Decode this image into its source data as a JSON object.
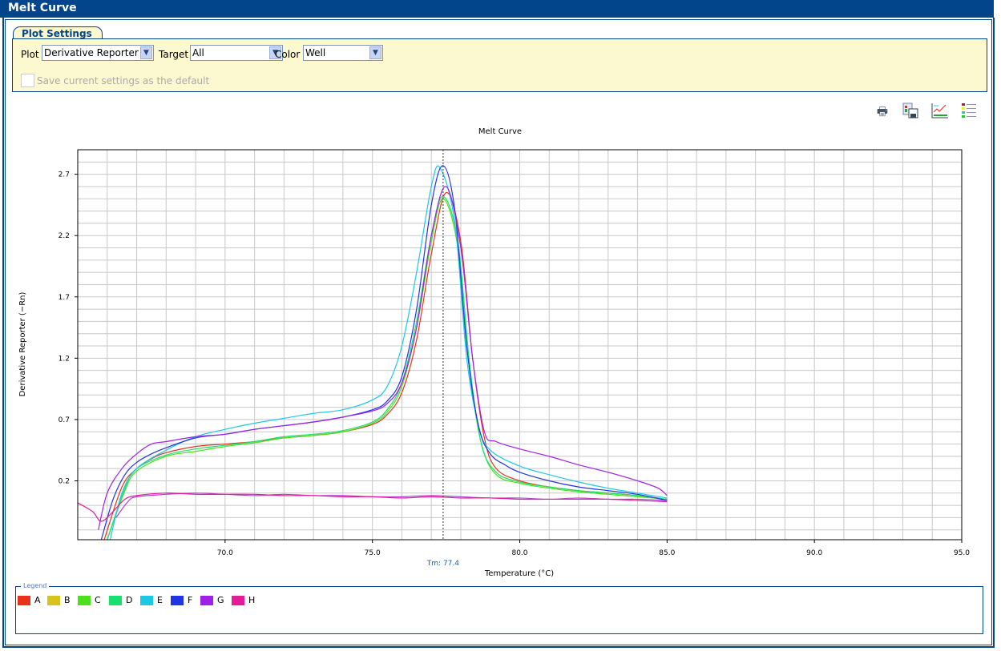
{
  "window": {
    "title": "Melt Curve"
  },
  "settings": {
    "tab": "Plot Settings",
    "plot_label": "Plot",
    "plot_value": "Derivative Reporter",
    "target_label": "Target",
    "target_value": "All",
    "color_label": "Color",
    "color_value": "Well",
    "save_default": "Save current settings as the default"
  },
  "toolbar": {
    "icons": [
      "print-icon",
      "save-image-icon",
      "edit-graph-icon",
      "legend-list-icon"
    ]
  },
  "legend": {
    "title": "Legend",
    "items": [
      {
        "label": "A",
        "color": "#e8321c"
      },
      {
        "label": "B",
        "color": "#d8c21c"
      },
      {
        "label": "C",
        "color": "#4ee01c"
      },
      {
        "label": "D",
        "color": "#18e070"
      },
      {
        "label": "E",
        "color": "#1cc8e6"
      },
      {
        "label": "F",
        "color": "#2034e4"
      },
      {
        "label": "G",
        "color": "#a020e8"
      },
      {
        "label": "H",
        "color": "#e41c98"
      }
    ]
  },
  "chart_data": {
    "type": "line",
    "title": "Melt Curve",
    "xlabel": "Temperature (°C)",
    "ylabel": "Derivative Reporter (−Rn)",
    "xlim": [
      65,
      95
    ],
    "ylim": [
      -0.28,
      2.9
    ],
    "xticks": [
      "70.0",
      "75.0",
      "80.0",
      "85.0",
      "90.0",
      "95.0"
    ],
    "yticks": [
      "0.2",
      "0.7",
      "1.2",
      "1.7",
      "2.2",
      "2.7"
    ],
    "grid": true,
    "annotation": {
      "label": "Tm: 77.4",
      "x": 77.4
    },
    "series": [
      {
        "name": "A",
        "color": "#e8321c",
        "points": [
          [
            65.9,
            -0.28
          ],
          [
            66.5,
            0.15
          ],
          [
            67,
            0.3
          ],
          [
            67.5,
            0.38
          ],
          [
            68,
            0.43
          ],
          [
            69,
            0.48
          ],
          [
            70,
            0.5
          ],
          [
            71,
            0.52
          ],
          [
            72,
            0.55
          ],
          [
            73,
            0.57
          ],
          [
            74,
            0.6
          ],
          [
            75,
            0.66
          ],
          [
            75.5,
            0.74
          ],
          [
            76,
            0.92
          ],
          [
            76.5,
            1.35
          ],
          [
            77,
            2.05
          ],
          [
            77.5,
            2.55
          ],
          [
            78,
            2.15
          ],
          [
            78.4,
            1.2
          ],
          [
            78.8,
            0.55
          ],
          [
            79.2,
            0.3
          ],
          [
            80,
            0.2
          ],
          [
            81,
            0.15
          ],
          [
            82,
            0.12
          ],
          [
            83,
            0.1
          ],
          [
            84,
            0.08
          ],
          [
            85,
            0.05
          ]
        ]
      },
      {
        "name": "B",
        "color": "#b83ed0",
        "points": [
          [
            66.3,
            -0.1
          ],
          [
            66.7,
            0.03
          ],
          [
            67,
            0.07
          ],
          [
            68,
            0.09
          ],
          [
            69,
            0.1
          ],
          [
            70,
            0.09
          ],
          [
            71,
            0.08
          ],
          [
            72,
            0.09
          ],
          [
            73,
            0.08
          ],
          [
            74,
            0.08
          ],
          [
            75,
            0.07
          ],
          [
            76,
            0.07
          ],
          [
            77,
            0.08
          ],
          [
            78,
            0.07
          ],
          [
            79,
            0.06
          ],
          [
            80,
            0.06
          ],
          [
            81,
            0.05
          ],
          [
            82,
            0.06
          ],
          [
            83,
            0.05
          ],
          [
            84,
            0.05
          ],
          [
            85,
            0.04
          ]
        ]
      },
      {
        "name": "C",
        "color": "#4ee01c",
        "points": [
          [
            66,
            -0.28
          ],
          [
            66.6,
            0.12
          ],
          [
            67,
            0.28
          ],
          [
            68,
            0.4
          ],
          [
            69,
            0.44
          ],
          [
            70,
            0.48
          ],
          [
            71,
            0.51
          ],
          [
            72,
            0.55
          ],
          [
            73,
            0.57
          ],
          [
            74,
            0.6
          ],
          [
            75,
            0.67
          ],
          [
            75.5,
            0.76
          ],
          [
            76,
            0.97
          ],
          [
            76.5,
            1.45
          ],
          [
            77,
            2.15
          ],
          [
            77.4,
            2.5
          ],
          [
            77.9,
            2.1
          ],
          [
            78.3,
            1.1
          ],
          [
            78.7,
            0.5
          ],
          [
            79.2,
            0.25
          ],
          [
            80,
            0.18
          ],
          [
            81,
            0.14
          ],
          [
            82,
            0.11
          ],
          [
            83,
            0.09
          ],
          [
            84,
            0.07
          ],
          [
            85,
            0.05
          ]
        ]
      },
      {
        "name": "D",
        "color": "#18e070",
        "points": [
          [
            66,
            -0.28
          ],
          [
            66.6,
            0.14
          ],
          [
            67,
            0.3
          ],
          [
            68,
            0.41
          ],
          [
            69,
            0.46
          ],
          [
            70,
            0.49
          ],
          [
            71,
            0.52
          ],
          [
            72,
            0.56
          ],
          [
            73,
            0.58
          ],
          [
            74,
            0.61
          ],
          [
            75,
            0.68
          ],
          [
            75.5,
            0.78
          ],
          [
            76,
            1.0
          ],
          [
            76.5,
            1.5
          ],
          [
            77,
            2.2
          ],
          [
            77.4,
            2.52
          ],
          [
            77.9,
            2.15
          ],
          [
            78.3,
            1.15
          ],
          [
            78.7,
            0.5
          ],
          [
            79.2,
            0.27
          ],
          [
            80,
            0.19
          ],
          [
            81,
            0.15
          ],
          [
            82,
            0.12
          ],
          [
            83,
            0.1
          ],
          [
            84,
            0.08
          ],
          [
            85,
            0.05
          ]
        ]
      },
      {
        "name": "E",
        "color": "#1cc8e6",
        "points": [
          [
            66.1,
            -0.28
          ],
          [
            66.5,
            0.1
          ],
          [
            67,
            0.3
          ],
          [
            68,
            0.45
          ],
          [
            69,
            0.56
          ],
          [
            70,
            0.62
          ],
          [
            71,
            0.67
          ],
          [
            72,
            0.71
          ],
          [
            73,
            0.75
          ],
          [
            74,
            0.78
          ],
          [
            75,
            0.86
          ],
          [
            75.5,
            0.97
          ],
          [
            76,
            1.3
          ],
          [
            76.5,
            1.9
          ],
          [
            77,
            2.6
          ],
          [
            77.3,
            2.75
          ],
          [
            77.8,
            2.3
          ],
          [
            78.2,
            1.2
          ],
          [
            78.6,
            0.65
          ],
          [
            79,
            0.45
          ],
          [
            80,
            0.32
          ],
          [
            81,
            0.25
          ],
          [
            82,
            0.19
          ],
          [
            83,
            0.14
          ],
          [
            84,
            0.1
          ],
          [
            85,
            0.06
          ]
        ]
      },
      {
        "name": "F",
        "color": "#2034e4",
        "points": [
          [
            65.8,
            -0.28
          ],
          [
            66.2,
            0.05
          ],
          [
            66.6,
            0.25
          ],
          [
            67,
            0.35
          ],
          [
            67.5,
            0.42
          ],
          [
            68,
            0.47
          ],
          [
            69,
            0.55
          ],
          [
            70,
            0.58
          ],
          [
            71,
            0.62
          ],
          [
            72,
            0.65
          ],
          [
            73,
            0.68
          ],
          [
            74,
            0.72
          ],
          [
            75,
            0.78
          ],
          [
            75.5,
            0.85
          ],
          [
            76,
            1.05
          ],
          [
            76.5,
            1.6
          ],
          [
            77,
            2.45
          ],
          [
            77.4,
            2.77
          ],
          [
            77.8,
            2.4
          ],
          [
            78.2,
            1.3
          ],
          [
            78.6,
            0.65
          ],
          [
            79,
            0.42
          ],
          [
            79.5,
            0.33
          ],
          [
            80,
            0.27
          ],
          [
            81,
            0.2
          ],
          [
            82,
            0.15
          ],
          [
            83,
            0.12
          ],
          [
            84,
            0.09
          ],
          [
            85,
            0.04
          ]
        ]
      },
      {
        "name": "G",
        "color": "#a020e8",
        "points": [
          [
            65.7,
            -0.2
          ],
          [
            66,
            0.1
          ],
          [
            66.5,
            0.3
          ],
          [
            67,
            0.42
          ],
          [
            67.5,
            0.5
          ],
          [
            68,
            0.52
          ],
          [
            69,
            0.56
          ],
          [
            70,
            0.58
          ],
          [
            71,
            0.62
          ],
          [
            72,
            0.65
          ],
          [
            73,
            0.68
          ],
          [
            74,
            0.72
          ],
          [
            75,
            0.77
          ],
          [
            75.5,
            0.83
          ],
          [
            76,
            1.0
          ],
          [
            76.5,
            1.45
          ],
          [
            77,
            2.2
          ],
          [
            77.5,
            2.6
          ],
          [
            78,
            2.1
          ],
          [
            78.4,
            1.2
          ],
          [
            78.8,
            0.6
          ],
          [
            79.2,
            0.52
          ],
          [
            80,
            0.46
          ],
          [
            81,
            0.4
          ],
          [
            82,
            0.33
          ],
          [
            83,
            0.27
          ],
          [
            84,
            0.2
          ],
          [
            84.7,
            0.14
          ],
          [
            85,
            0.08
          ]
        ]
      },
      {
        "name": "H",
        "color": "#e41c98",
        "points": [
          [
            65,
            0.02
          ],
          [
            65.5,
            -0.05
          ],
          [
            65.8,
            -0.13
          ],
          [
            66.2,
            -0.05
          ],
          [
            66.6,
            0.05
          ],
          [
            67,
            0.08
          ],
          [
            68,
            0.1
          ],
          [
            69,
            0.09
          ],
          [
            70,
            0.09
          ],
          [
            71,
            0.09
          ],
          [
            72,
            0.08
          ],
          [
            73,
            0.08
          ],
          [
            74,
            0.07
          ],
          [
            75,
            0.07
          ],
          [
            76,
            0.06
          ],
          [
            77,
            0.07
          ],
          [
            78,
            0.06
          ],
          [
            79,
            0.06
          ],
          [
            80,
            0.05
          ],
          [
            81,
            0.05
          ],
          [
            82,
            0.05
          ],
          [
            83,
            0.05
          ],
          [
            84,
            0.04
          ],
          [
            85,
            0.03
          ]
        ]
      }
    ]
  }
}
